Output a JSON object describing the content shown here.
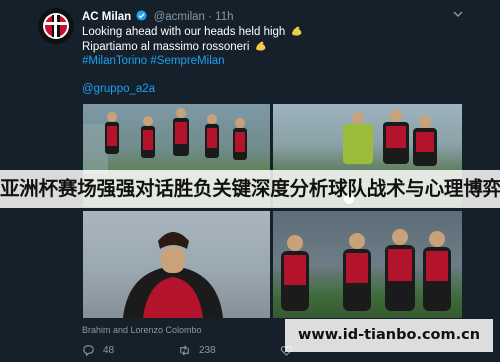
{
  "tweet": {
    "author_name": "AC Milan",
    "handle": "@acmilan",
    "separator": "·",
    "time": "11h",
    "lines": [
      "Looking ahead with our heads held high",
      "Ripartiamo al massimo rossoneri",
      "#MilanTorino #SempreMilan",
      "@gruppo_a2a"
    ],
    "photo_caption": "Brahim and Lorenzo Colombo",
    "reply_count": "48",
    "retweet_count": "238",
    "like_count": "",
    "icons": {
      "avatar": "ac-milan-crest",
      "verified": "verified-badge-icon",
      "menu": "chevron-down-icon",
      "emoji": "flexed-biceps-emoji",
      "reply": "reply-icon",
      "retweet": "retweet-icon",
      "like": "heart-icon"
    }
  },
  "overlay": {
    "banner_text": "亚洲杯赛场强强对话胜负关键深度分析球队战术与心理博弈",
    "watermark_text": "www.id-tianbo.com.cn"
  },
  "colors": {
    "background": "#15202b",
    "link": "#1da1f2",
    "muted": "#8899a6",
    "milan_red": "#c8102e"
  }
}
